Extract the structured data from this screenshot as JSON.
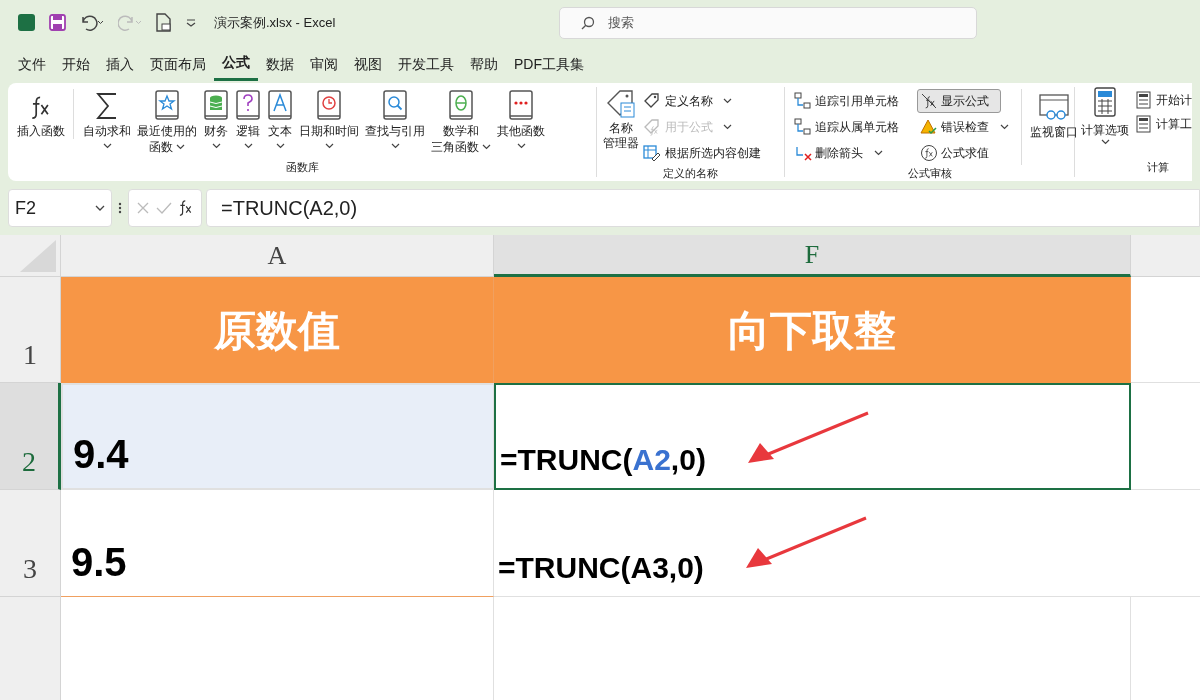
{
  "window": {
    "title": "演示案例.xlsx  -  Excel"
  },
  "search": {
    "placeholder": "搜索"
  },
  "tabs": [
    {
      "label": "文件",
      "selected": false
    },
    {
      "label": "开始",
      "selected": false
    },
    {
      "label": "插入",
      "selected": false
    },
    {
      "label": "页面布局",
      "selected": false
    },
    {
      "label": "公式",
      "selected": true
    },
    {
      "label": "数据",
      "selected": false
    },
    {
      "label": "审阅",
      "selected": false
    },
    {
      "label": "视图",
      "selected": false
    },
    {
      "label": "开发工具",
      "selected": false
    },
    {
      "label": "帮助",
      "selected": false
    },
    {
      "label": "PDF工具集",
      "selected": false
    }
  ],
  "ribbon": {
    "function_library": {
      "title": "函数库",
      "buttons": [
        {
          "label_lines": [
            "插入函数"
          ],
          "dropdown": false
        },
        {
          "label_lines": [
            "自动求和"
          ],
          "dropdown": true
        },
        {
          "label_lines": [
            "最近使用的",
            "函数"
          ],
          "dropdown": true
        },
        {
          "label_lines": [
            "财务"
          ],
          "dropdown": true
        },
        {
          "label_lines": [
            "逻辑"
          ],
          "dropdown": true
        },
        {
          "label_lines": [
            "文本"
          ],
          "dropdown": true
        },
        {
          "label_lines": [
            "日期和时间"
          ],
          "dropdown": true
        },
        {
          "label_lines": [
            "查找与引用"
          ],
          "dropdown": true
        },
        {
          "label_lines": [
            "数学和",
            "三角函数"
          ],
          "dropdown": true
        },
        {
          "label_lines": [
            "其他函数"
          ],
          "dropdown": true
        }
      ]
    },
    "defined_names": {
      "title": "定义的名称",
      "big_button": {
        "label_lines": [
          "名称",
          "管理器"
        ]
      },
      "items": [
        {
          "label": "定义名称",
          "dropdown": true,
          "disabled": false
        },
        {
          "label": "用于公式",
          "dropdown": true,
          "disabled": true
        },
        {
          "label": "根据所选内容创建",
          "dropdown": false,
          "disabled": false
        }
      ]
    },
    "formula_auditing": {
      "title": "公式审核",
      "items": [
        {
          "label": "追踪引用单元格",
          "dropdown": false,
          "selected": false
        },
        {
          "label": "显示公式",
          "dropdown": false,
          "selected": true
        },
        {
          "label": "追踪从属单元格",
          "dropdown": false,
          "selected": false
        },
        {
          "label": "错误检查",
          "dropdown": true,
          "selected": false
        },
        {
          "label": "删除箭头",
          "dropdown": true,
          "selected": false
        },
        {
          "label": "公式求值",
          "dropdown": false,
          "selected": false
        }
      ],
      "watch": {
        "label": "监视窗口"
      }
    },
    "calculation": {
      "title": "计算",
      "big_button": {
        "label": "计算选项"
      },
      "items": [
        {
          "label": "开始计"
        },
        {
          "label": "计算工"
        }
      ]
    }
  },
  "formula_bar": {
    "name_box": "F2",
    "formula": "=TRUNC(A2,0)"
  },
  "columns": [
    {
      "label": "A",
      "selected": false
    },
    {
      "label": "F",
      "selected": true
    }
  ],
  "rows": [
    {
      "number": "1",
      "selected": false,
      "kind": "header",
      "cells": [
        {
          "text": "原数值"
        },
        {
          "text": "向下取整"
        }
      ]
    },
    {
      "number": "2",
      "selected": true,
      "kind": "data",
      "annotated": true,
      "cells": [
        {
          "text": "9.4",
          "highlighted": true
        },
        {
          "parts": [
            {
              "text": "=TRUNC(",
              "reference": false
            },
            {
              "text": "A2",
              "reference": true
            },
            {
              "text": ",0)",
              "reference": false
            }
          ],
          "active": true
        }
      ]
    },
    {
      "number": "3",
      "selected": false,
      "kind": "data",
      "annotated": true,
      "cells": [
        {
          "text": "9.5",
          "highlighted": false
        },
        {
          "parts": [
            {
              "text": "=TRUNC(A3,0)",
              "reference": false
            }
          ],
          "active": false
        }
      ]
    }
  ]
}
